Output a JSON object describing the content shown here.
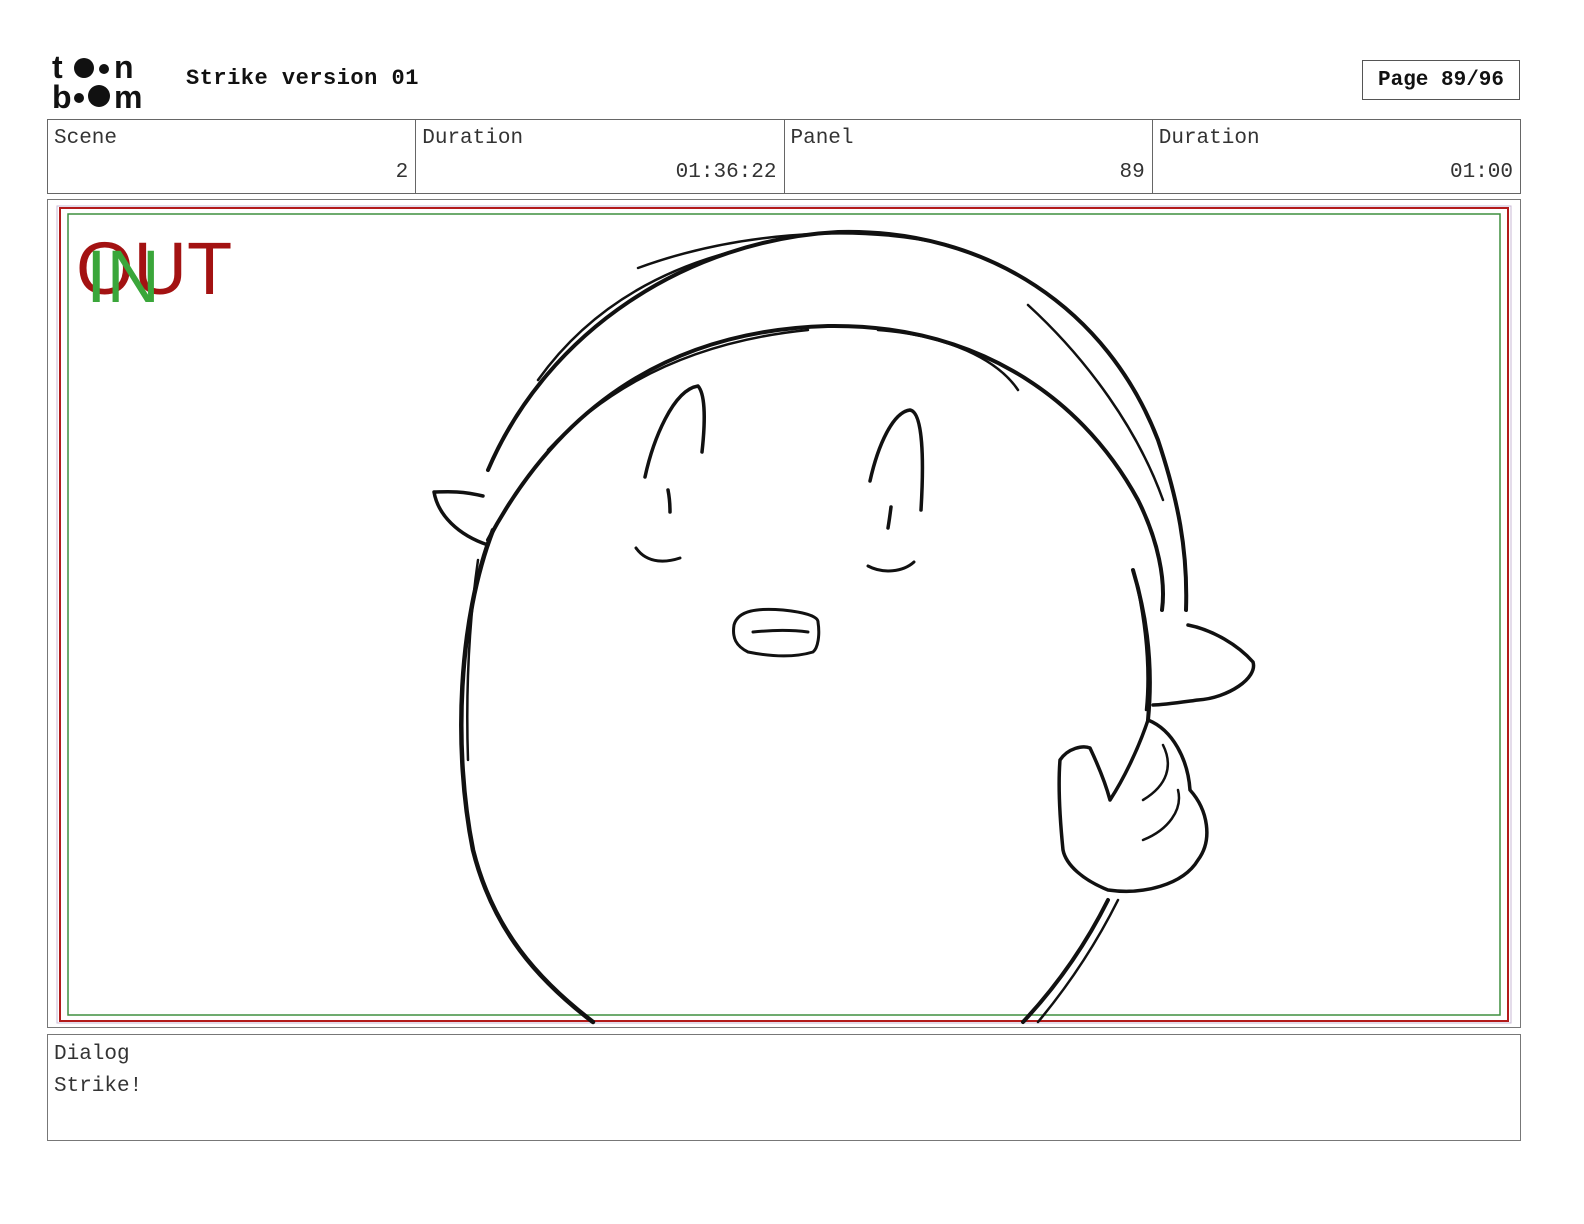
{
  "header": {
    "logo_text": "toon boom",
    "project_title": "Strike version 01",
    "page_label": "Page 89/96"
  },
  "info": {
    "scene_label": "Scene",
    "scene_value": "2",
    "scene_duration_label": "Duration",
    "scene_duration_value": "01:36:22",
    "panel_label": "Panel",
    "panel_value": "89",
    "panel_duration_label": "Duration",
    "panel_duration_value": "01:00"
  },
  "panel": {
    "out_label": "OUT",
    "in_label": "IN",
    "colors": {
      "out": "#a31212",
      "in": "#3aa63a"
    }
  },
  "dialog": {
    "label": "Dialog",
    "text": "Strike!"
  }
}
